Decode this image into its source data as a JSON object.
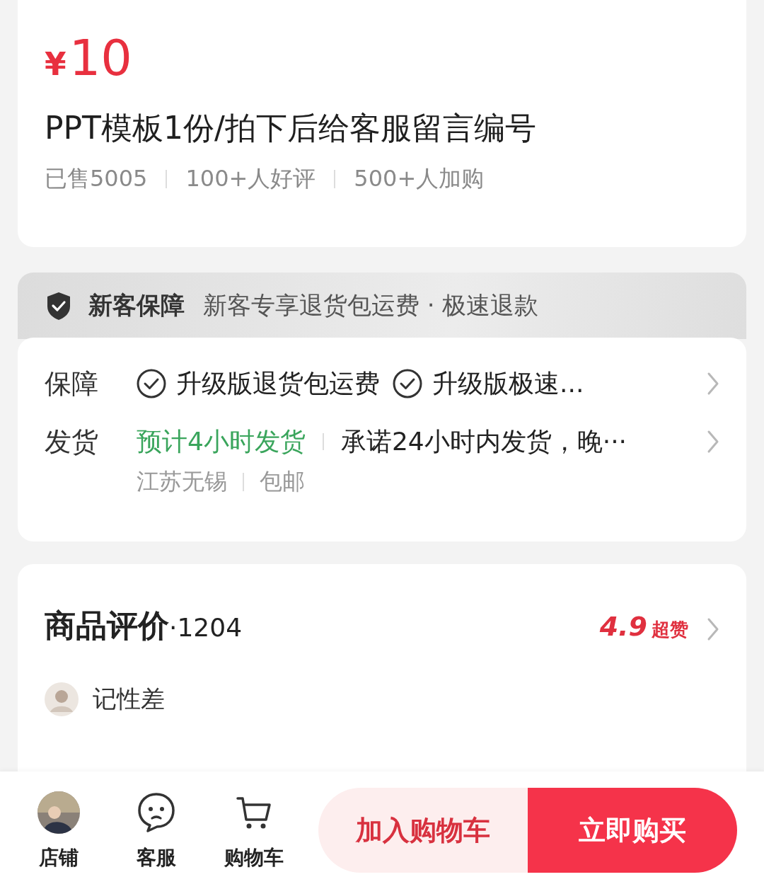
{
  "price": {
    "currency": "¥",
    "amount": "10"
  },
  "title": "PPT模板1份/拍下后给客服留言编号",
  "stats": [
    "已售5005",
    "100+人好评",
    "500+人加购"
  ],
  "guarantee_banner": {
    "label": "新客保障",
    "text": "新客专享退货包运费 · 极速退款"
  },
  "services": [
    {
      "kind": "guarantee",
      "label": "保障",
      "items": [
        "升级版退货包运费",
        "升级版极速..."
      ]
    },
    {
      "kind": "shipping",
      "label": "发货",
      "highlight": "预计4小时发货",
      "text": "承诺24小时内发货，晚···",
      "details": [
        "江苏无锡",
        "包邮"
      ]
    }
  ],
  "reviews": {
    "title": "商品评价",
    "count": "·1204",
    "rating": "4.9",
    "rating_label": "超赞",
    "reviewer": "记性差"
  },
  "bottom_bar": {
    "actions": [
      {
        "kind": "shop",
        "label": "店铺"
      },
      {
        "kind": "service",
        "label": "客服"
      },
      {
        "kind": "cart",
        "label": "购物车"
      }
    ],
    "buttons": [
      {
        "kind": "add_to_cart",
        "label": "加入购物车"
      },
      {
        "kind": "buy",
        "label": "立即购买"
      }
    ]
  }
}
